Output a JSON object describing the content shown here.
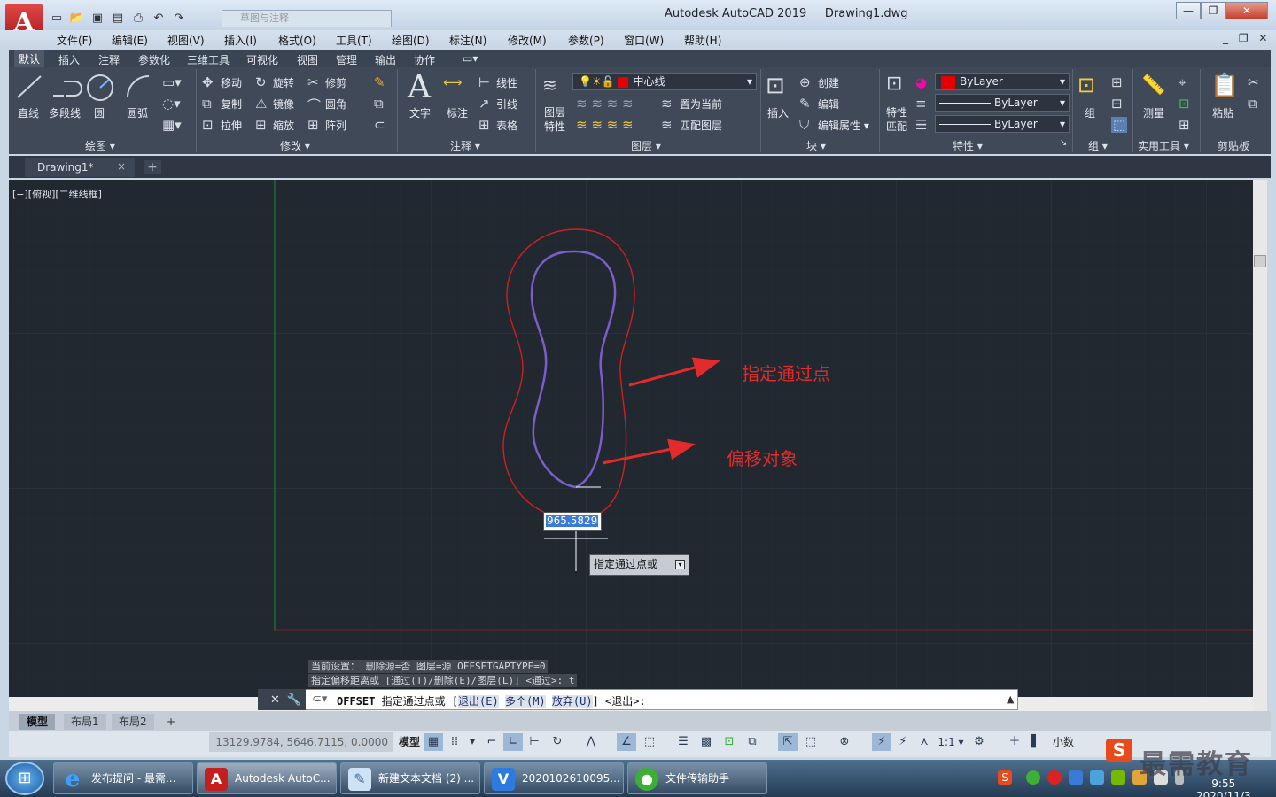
{
  "app": {
    "title": "Autodesk AutoCAD 2019",
    "file": "Drawing1.dwg",
    "workspace_placeholder": "草图与注释"
  },
  "window_buttons": {
    "minimize": "—",
    "restore": "❐",
    "close": "✕"
  },
  "menu": [
    "文件(F)",
    "编辑(E)",
    "视图(V)",
    "插入(I)",
    "格式(O)",
    "工具(T)",
    "绘图(D)",
    "标注(N)",
    "修改(M)",
    "参数(P)",
    "窗口(W)",
    "帮助(H)"
  ],
  "menu_right": "_ ❐ ✕",
  "ribbon_tabs": [
    "默认",
    "插入",
    "注释",
    "参数化",
    "三维工具",
    "可视化",
    "视图",
    "管理",
    "输出",
    "协作"
  ],
  "draw": {
    "line": "直线",
    "polyline": "多段线",
    "circle": "圆",
    "arc": "圆弧",
    "title": "绘图 ▾"
  },
  "modify": {
    "move": "移动",
    "rotate": "旋转",
    "trim": "修剪",
    "copy": "复制",
    "mirror": "镜像",
    "fillet": "圆角",
    "stretch": "拉伸",
    "scale": "缩放",
    "array": "阵列",
    "title": "修改 ▾"
  },
  "annotation": {
    "text": "文字",
    "dimension": "标注",
    "linear": "线性",
    "leader": "引线",
    "table": "表格",
    "title": "注释 ▾"
  },
  "layers": {
    "layer_props": "图层特性",
    "current_layer": "中心线",
    "set_current": "置为当前",
    "match_layer": "匹配图层",
    "title": "图层 ▾"
  },
  "block": {
    "insert": "插入",
    "create": "创建",
    "edit": "编辑",
    "edit_attr": "编辑属性 ▾",
    "title": "块 ▾"
  },
  "properties": {
    "match": "特性匹配",
    "color": "ByLayer",
    "linetype": "ByLayer",
    "lineweight": "ByLayer",
    "title": "特性 ▾",
    "launcher": "↘"
  },
  "groups": {
    "group": "组",
    "title": "组 ▾"
  },
  "utilities": {
    "measure": "测量",
    "title": "实用工具 ▾"
  },
  "clipboard": {
    "paste": "粘贴",
    "title": "剪贴板"
  },
  "doc_tab": {
    "name": "Drawing1*",
    "close": "×",
    "add": "+"
  },
  "viewport_label": "[−][俯视][二维线框]",
  "annotations": {
    "pass_point": "指定通过点",
    "offset_object": "偏移对象"
  },
  "dynamic_input": {
    "value": "965.5829",
    "prompt": "指定通过点或"
  },
  "command": {
    "history1": "当前设置： 删除源=否  图层=源  OFFSETGAPTYPE=0",
    "history2": "指定偏移距离或 [通过(T)/删除(E)/图层(L)] <通过>:  t",
    "cmd_name": "OFFSET",
    "prompt": "指定通过点或 [",
    "opt1": "退出(E)",
    "opt2": "多个(M)",
    "opt3": "放弃(U)",
    "tail": "] <退出>:"
  },
  "layout_tabs": [
    "模型",
    "布局1",
    "布局2"
  ],
  "status": {
    "coords": "13129.9784, 5646.7115, 0.0000",
    "model": "模型",
    "scale": "1:1 ▾",
    "units": "小数"
  },
  "taskbar": [
    {
      "label": "发布提问 - 最需...",
      "icon": "ie-icon"
    },
    {
      "label": "Autodesk AutoC...",
      "icon": "autocad-icon"
    },
    {
      "label": "新建文本文档 (2) ...",
      "icon": "notepad-icon"
    },
    {
      "label": "2020102610095...",
      "icon": "vw-icon"
    },
    {
      "label": "文件传输助手",
      "icon": "wechat-icon"
    }
  ],
  "clock": {
    "time": "9:55",
    "date": "2020/11/3"
  },
  "watermark": "最需教育",
  "colors": {
    "accent_red": "#e32b2b",
    "canvas": "#212830",
    "curve_outer": "#d11f1f",
    "curve_inner": "#7a5ec9"
  }
}
